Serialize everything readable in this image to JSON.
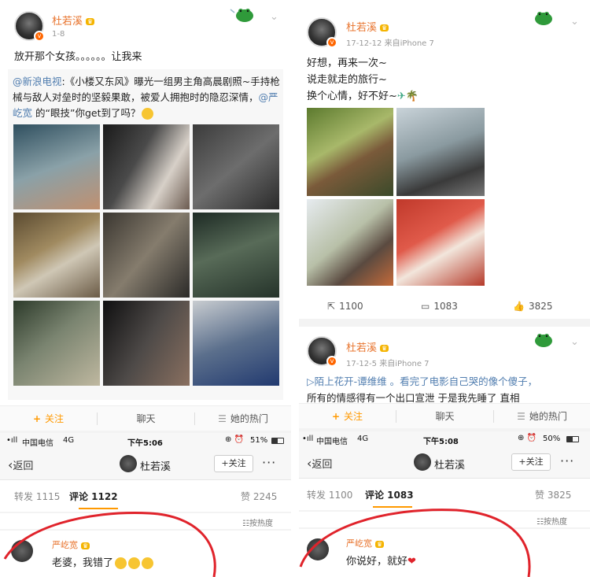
{
  "left": {
    "post": {
      "author": "杜若溪",
      "crown": "👑",
      "date": "1-8",
      "text": "放开那个女孩。。。。。。让我来",
      "repost_mention": "@新浪电视",
      "repost_text": ":《小楼又东风》曝光一组男主角高晨剧照~手持枪械与敌人对垒时的坚毅果敢，被爱人拥抱时的隐忍深情，",
      "repost_mention2": "@严屹宽",
      "repost_text2": " 的“眼技”你get到了吗？",
      "actions": {
        "follow": "关注",
        "chat": "聊天",
        "hot": "她的热门"
      }
    },
    "status": {
      "carrier": "中国电信",
      "network": "4G",
      "time": "下午5:06",
      "battery": "51%"
    },
    "nav": {
      "back": "返回",
      "name": "杜若溪",
      "follow": "+关注",
      "more": "···"
    },
    "tabs": {
      "repost": "转发 1115",
      "comment": "评论 1122",
      "likes": "赞 2245"
    },
    "sort": "按热度",
    "comment": {
      "name": "严屹宽",
      "text": "老婆，我错了"
    }
  },
  "right": {
    "post1": {
      "author": "杜若溪",
      "date": "17-12-12",
      "source": "来自iPhone 7",
      "lines": [
        "好想，再来一次~",
        "说走就走的旅行~",
        "换个心情，好不好~"
      ],
      "reposts": "1100",
      "comments": "1083",
      "likes": "3825"
    },
    "post2": {
      "author": "杜若溪",
      "date": "17-12-5",
      "source": "来自iPhone 7",
      "line1": "▷陌上花开-谭维维 。看完了电影自己哭的像个傻子，",
      "line2": "所有的情感得有一个出口宣泄    于是我先睡了    直相",
      "actions": {
        "follow": "关注",
        "chat": "聊天",
        "hot": "她的热门"
      }
    },
    "status": {
      "carrier": "中国电信",
      "network": "4G",
      "time": "下午5:08",
      "battery": "50%"
    },
    "nav": {
      "back": "返回",
      "name": "杜若溪",
      "follow": "+关注",
      "more": "···"
    },
    "tabs": {
      "repost": "转发 1100",
      "comment": "评论 1083",
      "likes": "赞 3825"
    },
    "sort": "按热度",
    "comment": {
      "name": "严屹宽",
      "text": "你说好，就好"
    }
  },
  "colors": {
    "username": "#e8742e",
    "link": "#507daf",
    "accent": "#ff9900",
    "annotation": "#e0232b"
  },
  "icons": {
    "verified": "v-badge-icon",
    "frog": "frog-sticker-icon",
    "repost": "repost-icon",
    "comment": "comment-icon",
    "like": "thumb-up-icon"
  }
}
